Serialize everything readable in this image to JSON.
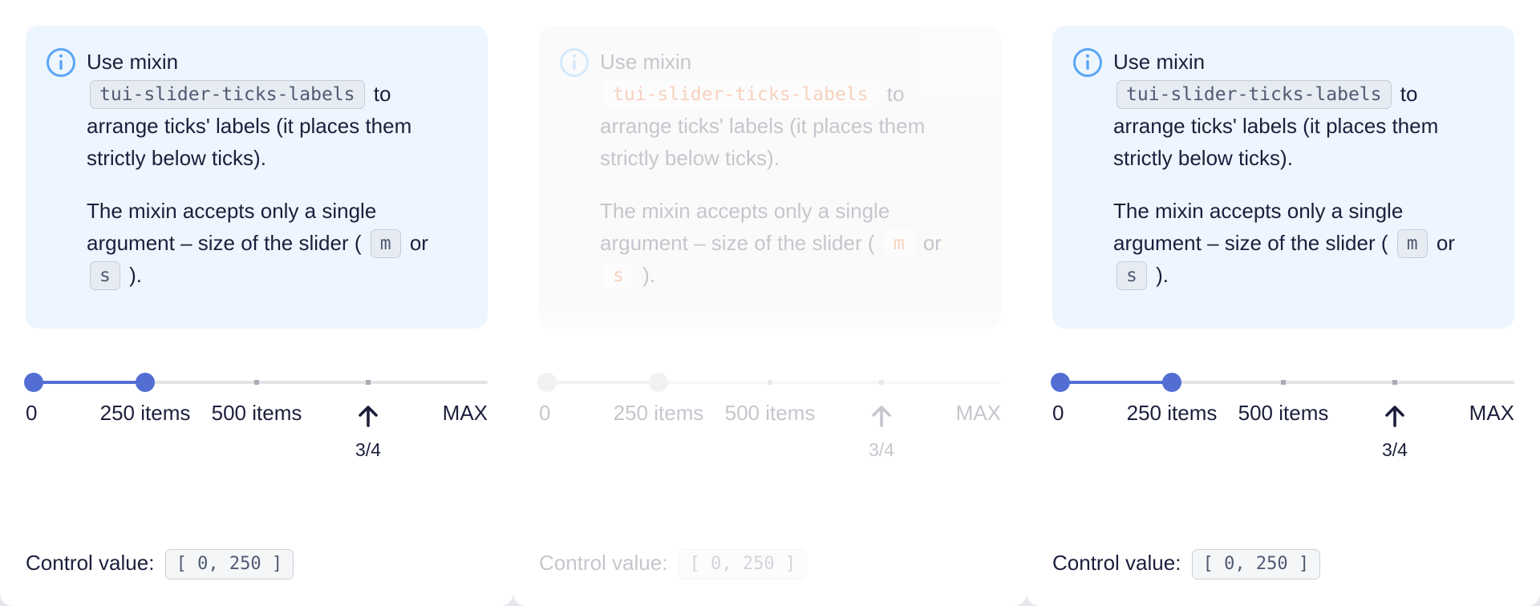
{
  "demos": [
    {
      "state": "enabled",
      "callout": {
        "icon": "info-circle-icon",
        "line1_before": "Use mixin",
        "mixin_code": "tui-slider-ticks-labels",
        "line1_after": "to arrange ticks' labels (it places them strictly below ticks).",
        "para2_before": "The mixin accepts only a single argument – size of the slider (",
        "size_m": "m",
        "para2_or": "or",
        "size_s": "s",
        "para2_after": ")."
      },
      "slider": {
        "range_start": 0,
        "range_end": 250,
        "labels": [
          "0",
          "250 items",
          "500 items",
          "MAX"
        ],
        "marker_icon": "arrow-up-icon",
        "marker_label": "3/4"
      },
      "control": {
        "label": "Control value:",
        "value": "[ 0, 250 ]"
      }
    },
    {
      "state": "disabled",
      "callout": {
        "icon": "info-circle-icon",
        "line1_before": "Use mixin",
        "mixin_code": "tui-slider-ticks-labels",
        "line1_after": "to arrange ticks' labels (it places them strictly below ticks).",
        "para2_before": "The mixin accepts only a single argument – size of the slider (",
        "size_m": "m",
        "para2_or": "or",
        "size_s": "s",
        "para2_after": ")."
      },
      "slider": {
        "range_start": 0,
        "range_end": 250,
        "labels": [
          "0",
          "250 items",
          "500 items",
          "MAX"
        ],
        "marker_icon": "arrow-up-icon",
        "marker_label": "3/4"
      },
      "control": {
        "label": "Control value:",
        "value": "[ 0, 250 ]"
      }
    },
    {
      "state": "enabled",
      "callout": {
        "icon": "info-circle-icon",
        "line1_before": "Use mixin",
        "mixin_code": "tui-slider-ticks-labels",
        "line1_after": "to arrange ticks' labels (it places them strictly below ticks).",
        "para2_before": "The mixin accepts only a single argument – size of the slider (",
        "size_m": "m",
        "para2_or": "or",
        "size_s": "s",
        "para2_after": ")."
      },
      "slider": {
        "range_start": 0,
        "range_end": 250,
        "labels": [
          "0",
          "250 items",
          "500 items",
          "MAX"
        ],
        "marker_icon": "arrow-up-icon",
        "marker_label": "3/4"
      },
      "control": {
        "label": "Control value:",
        "value": "[ 0, 250 ]"
      }
    }
  ],
  "colors": {
    "accent": "#526ed3",
    "callout_bg": "#edf5fe",
    "info_icon": "#5aa6f5",
    "text": "#1b1f3b",
    "code_text": "#4f5a72",
    "disabled_code_text": "#e24a00"
  }
}
